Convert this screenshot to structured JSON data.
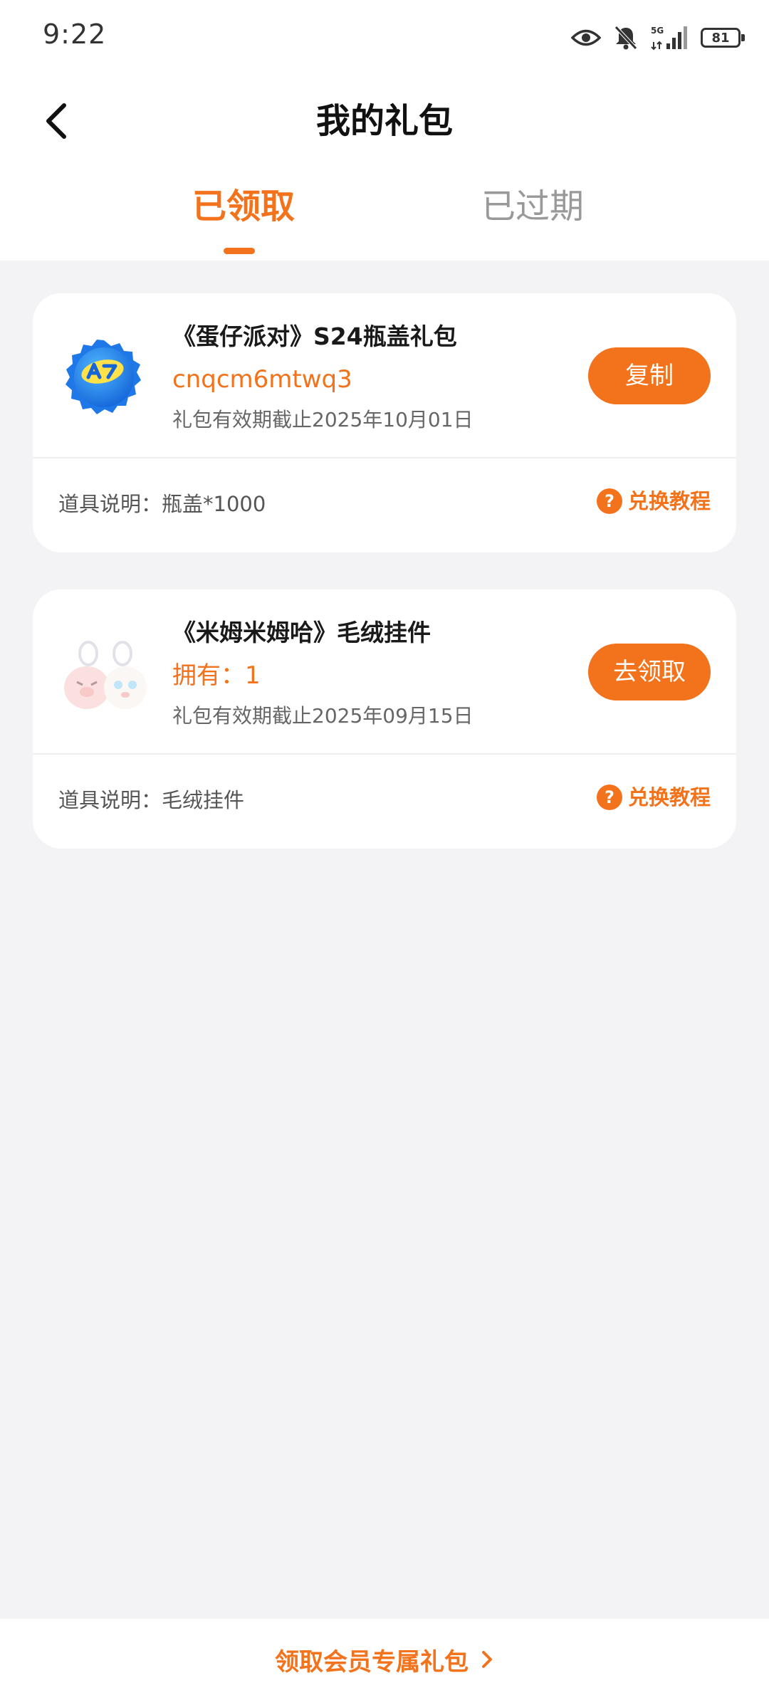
{
  "status_bar": {
    "time": "9:22",
    "network_label": "5G",
    "battery_level": "81",
    "icons": [
      "eye-icon",
      "bell-off-icon",
      "signal-icon",
      "battery-icon"
    ]
  },
  "header": {
    "title": "我的礼包",
    "back_icon": "chevron-left-icon"
  },
  "tabs": [
    {
      "label": "已领取",
      "active": true
    },
    {
      "label": "已过期",
      "active": false
    }
  ],
  "gifts": [
    {
      "name": "《蛋仔派对》S24瓶盖礼包",
      "code": "cnqcm6mtwq3",
      "expiry": "礼包有效期截止2025年10月01日",
      "action_label": "复制",
      "item_desc": "道具说明：瓶盖*1000",
      "tutorial_label": "兑换教程",
      "image": "bottle-cap-icon"
    },
    {
      "name": "《米姆米姆哈》毛绒挂件",
      "code": "拥有：1",
      "expiry": "礼包有效期截止2025年09月15日",
      "action_label": "去领取",
      "item_desc": "道具说明：毛绒挂件",
      "tutorial_label": "兑换教程",
      "image": "plush-keychain-icon"
    }
  ],
  "footer": {
    "link_label": "领取会员专属礼包"
  },
  "colors": {
    "accent": "#f2731c",
    "background": "#f3f3f5",
    "card": "#ffffff",
    "inactive_tab": "#999999"
  }
}
